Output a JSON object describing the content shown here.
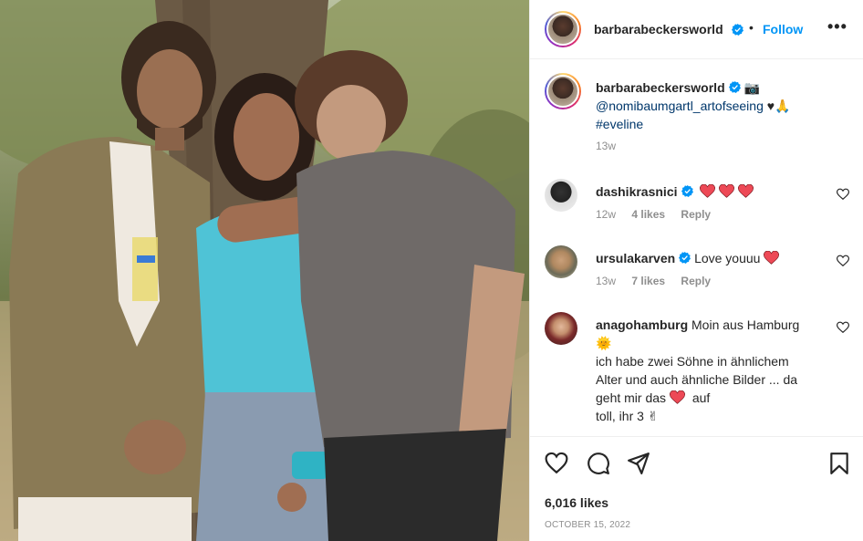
{
  "post": {
    "username": "barbarabeckersworld",
    "follow_label": "Follow",
    "separator": "•",
    "more_label": "•••"
  },
  "caption": {
    "username": "barbarabeckersworld",
    "mention": "@nomibaumgartl_artofseeing",
    "hashtag": "#eveline",
    "emoji_camera": "📷",
    "emoji_heart": "♥",
    "emoji_pray": "🙏",
    "time": "13w"
  },
  "comments": [
    {
      "username": "dashikrasnici",
      "text": "",
      "time": "12w",
      "likes": "4 likes",
      "reply": "Reply"
    },
    {
      "username": "ursulakarven",
      "text": "Love youuu",
      "time": "13w",
      "likes": "7 likes",
      "reply": "Reply"
    },
    {
      "username": "anagohamburg",
      "text_line1": "Moin aus Hamburg",
      "emoji_sun": "🌞",
      "text_line2": "ich habe zwei Söhne in ähnlichem",
      "text_line3": "Alter und auch ähnliche Bilder ... da",
      "text_line4a": "geht mir das",
      "text_line4b": "auf",
      "text_line5": "toll, ihr 3",
      "emoji_peace": "✌"
    }
  ],
  "footer": {
    "likes": "6,016 likes",
    "date": "OCTOBER 15, 2022"
  },
  "colors": {
    "link": "#00376b",
    "follow": "#0095f6",
    "heart_red": "#ed4956",
    "verified_blue": "#0095f6"
  },
  "icons": [
    "verified-icon",
    "heart-icon",
    "comment-icon",
    "share-icon",
    "bookmark-icon",
    "more-icon"
  ]
}
